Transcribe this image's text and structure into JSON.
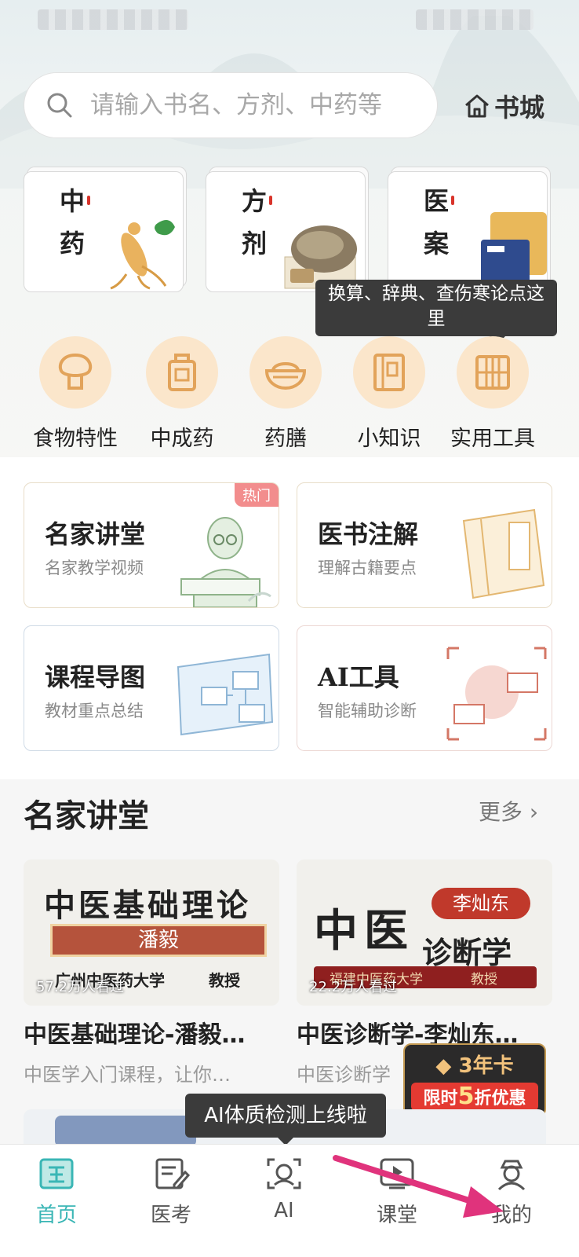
{
  "search": {
    "placeholder": "请输入书名、方剂、中药等"
  },
  "header": {
    "bookstore_label": "书城"
  },
  "categories": [
    {
      "label": "中药"
    },
    {
      "label": "方剂"
    },
    {
      "label": "医案"
    }
  ],
  "tooltip_tools": "换算、辞典、查伤寒论点这里",
  "tools": [
    {
      "label": "食物特性",
      "icon": "mushroom-icon"
    },
    {
      "label": "中成药",
      "icon": "medicine-bottle-icon"
    },
    {
      "label": "药膳",
      "icon": "bowl-icon"
    },
    {
      "label": "小知识",
      "icon": "book-icon"
    },
    {
      "label": "实用工具",
      "icon": "abacus-icon"
    }
  ],
  "features": [
    {
      "title": "名家讲堂",
      "subtitle": "名家教学视频",
      "badge": "热门"
    },
    {
      "title": "医书注解",
      "subtitle": "理解古籍要点"
    },
    {
      "title": "课程导图",
      "subtitle": "教材重点总结"
    },
    {
      "title": "AI工具",
      "subtitle": "智能辅助诊断"
    }
  ],
  "section": {
    "title": "名家讲堂",
    "more": "更多 ›"
  },
  "videos": [
    {
      "title": "中医基础理论-潘毅…",
      "desc": "中医学入门课程，让你…",
      "views": "57.2万人看过",
      "cover_title": "中医基础理论",
      "cover_name": "潘毅",
      "cover_org": "广州中医药大学",
      "cover_role": "教授"
    },
    {
      "title": "中医诊断学-李灿东…",
      "desc": "中医诊断学",
      "views": "22.2万人看过",
      "cover_title_a": "中医",
      "cover_title_b": "诊断学",
      "cover_name": "李灿东",
      "cover_org": "福建中医药大学",
      "cover_role": "教授"
    }
  ],
  "promo": {
    "card": "3年卡",
    "deal_prefix": "限时",
    "deal_num": "5",
    "deal_suffix": "折优惠"
  },
  "tooltip_ai": "AI体质检测上线啦",
  "nav": [
    {
      "label": "首页",
      "icon": "home-book-icon",
      "active": true
    },
    {
      "label": "医考",
      "icon": "exam-icon"
    },
    {
      "label": "AI",
      "icon": "ai-face-icon"
    },
    {
      "label": "课堂",
      "icon": "play-icon"
    },
    {
      "label": "我的",
      "icon": "profile-icon"
    }
  ],
  "colors": {
    "accent": "#3ab6b5",
    "tool_bg": "#fbe6cb",
    "tool_icon": "#e2a35a",
    "promo_red": "#e43a32"
  }
}
